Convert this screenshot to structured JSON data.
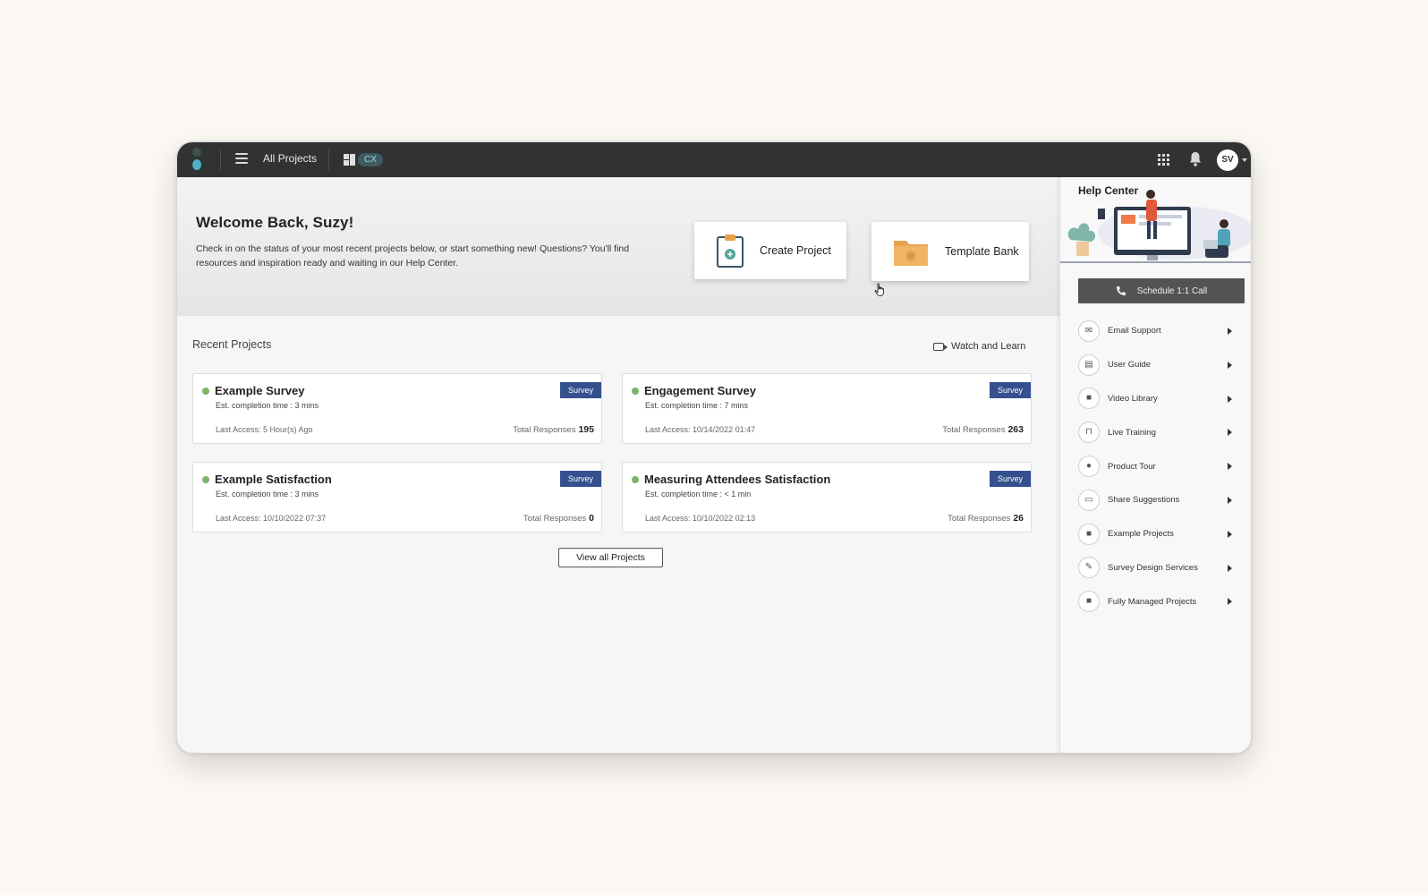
{
  "topbar": {
    "all_projects_label": "All Projects",
    "workspace_pill": "CX",
    "avatar_initials": "SV"
  },
  "hero": {
    "welcome": "Welcome Back, Suzy!",
    "text": "Check in on the status of your most recent projects below, or start something new! Questions? You'll find resources and inspiration ready and waiting in our Help Center.",
    "create_label": "Create Project",
    "template_label": "Template Bank"
  },
  "main": {
    "recent_title": "Recent Projects",
    "watch_label": "Watch and Learn",
    "view_all_label": "View all Projects",
    "projects": [
      {
        "title": "Example Survey",
        "est": "Est. completion time : 3 mins",
        "last_access": "Last Access: 5 Hour(s) Ago",
        "badge": "Survey",
        "responses_label": "Total Responses",
        "responses": "195"
      },
      {
        "title": "Engagement Survey",
        "est": "Est. completion time : 7 mins",
        "last_access": "Last Access: 10/14/2022 01:47",
        "badge": "Survey",
        "responses_label": "Total Responses",
        "responses": "263"
      },
      {
        "title": "Example Satisfaction",
        "est": "Est. completion time : 3 mins",
        "last_access": "Last Access: 10/10/2022 07:37",
        "badge": "Survey",
        "responses_label": "Total Responses",
        "responses": "0"
      },
      {
        "title": "Measuring Attendees Satisfaction",
        "est": "Est. completion time : < 1 min",
        "last_access": "Last Access: 10/10/2022 02:13",
        "badge": "Survey",
        "responses_label": "Total Responses",
        "responses": "26"
      }
    ]
  },
  "sidebar": {
    "title": "Help Center",
    "schedule_label": "Schedule 1:1 Call",
    "items": [
      {
        "label": "Email Support",
        "icon": "envelope-icon",
        "glyph": "✉"
      },
      {
        "label": "User Guide",
        "icon": "document-icon",
        "glyph": "▤"
      },
      {
        "label": "Video Library",
        "icon": "video-icon",
        "glyph": "■"
      },
      {
        "label": "Live Training",
        "icon": "cart-icon",
        "glyph": "⊓"
      },
      {
        "label": "Product Tour",
        "icon": "map-pin-icon",
        "glyph": "●"
      },
      {
        "label": "Share Suggestions",
        "icon": "chat-icon",
        "glyph": "▭"
      },
      {
        "label": "Example Projects",
        "icon": "briefcase-icon",
        "glyph": "■"
      },
      {
        "label": "Survey Design Services",
        "icon": "survey-icon",
        "glyph": "✎"
      },
      {
        "label": "Fully Managed Projects",
        "icon": "briefcase-icon",
        "glyph": "■"
      }
    ]
  },
  "colors": {
    "topbar": "#303233",
    "badge": "#34508e",
    "status_dot": "#7bb56a",
    "template_folder": "#e8a24f"
  }
}
